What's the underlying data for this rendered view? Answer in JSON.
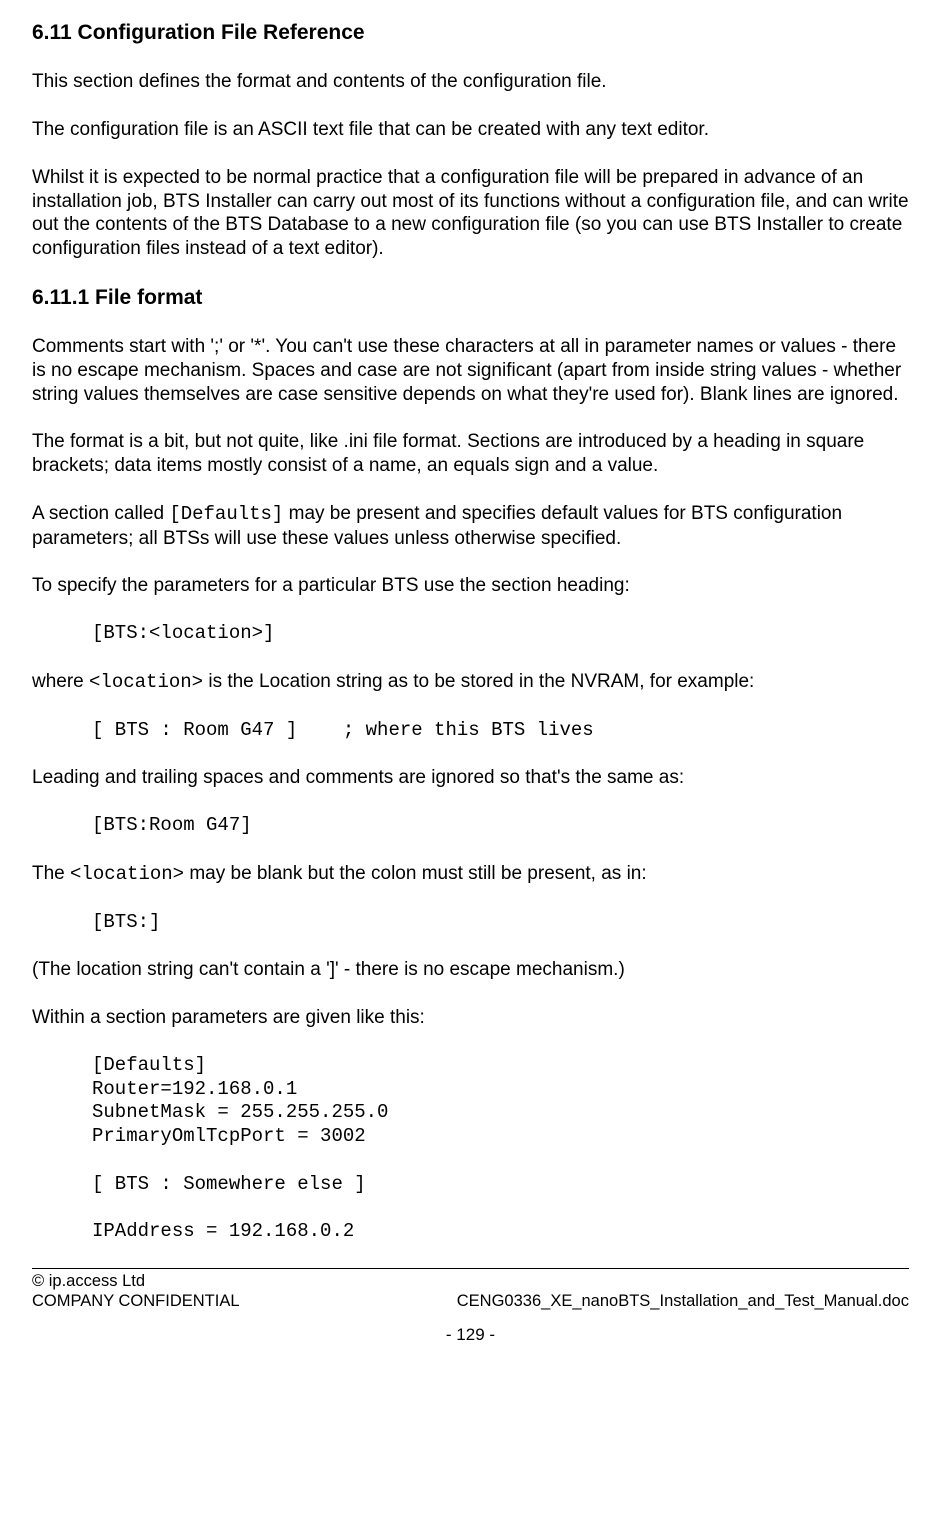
{
  "heading_main": "6.11 Configuration File Reference",
  "p1": "This section defines the format and contents of the configuration file.",
  "p2": "The configuration file is an ASCII text file that can be created with any text editor.",
  "p3": "Whilst it is expected to be normal practice that a configuration file will be prepared in advance of an installation job, BTS Installer can carry out most of its functions without a configuration file, and can write out the contents of the BTS Database to a new configuration file (so you can use BTS Installer to create configuration files instead of a text editor).",
  "heading_sub": "6.11.1 File format",
  "p4": "Comments start with ';' or '*'. You can't use these characters at all in parameter names or values - there is no escape mechanism. Spaces and case are not significant (apart from inside string  values - whether string values themselves are case sensitive depends on what they're used for). Blank lines are ignored.",
  "p5": "The format is a bit, but not quite, like .ini file format. Sections are introduced by a heading in square brackets; data items mostly consist of a name, an equals sign and a value.",
  "p6a": "A section called ",
  "p6_code": "[Defaults]",
  "p6b": " may be present and specifies default values for BTS configuration parameters; all BTSs will use these values unless otherwise specified.",
  "p7": "To specify the parameters for a particular BTS use the section heading:",
  "code1": "[BTS:<location>]",
  "p8a": "where ",
  "p8_code": "<location>",
  "p8b": " is the Location string as to be stored in the NVRAM, for example:",
  "code2": "[ BTS : Room G47 ]    ; where this BTS lives",
  "p9": "Leading and trailing spaces and comments are ignored so that's the same as:",
  "code3": "[BTS:Room G47]",
  "p10a": "The ",
  "p10_code": "<location>",
  "p10b": " may be blank but the colon must still be present, as in:",
  "code4": "[BTS:]",
  "p11": "(The location string can't contain a ']' - there is no escape mechanism.)",
  "p12": "Within a section parameters are given like this:",
  "code5": "[Defaults]\nRouter=192.168.0.1\nSubnetMask = 255.255.255.0\nPrimaryOmlTcpPort = 3002\n\n[ BTS : Somewhere else ]\n\nIPAddress = 192.168.0.2",
  "footer_copyright": "© ip.access Ltd",
  "footer_confidential": "COMPANY CONFIDENTIAL",
  "footer_docname": "CENG0336_XE_nanoBTS_Installation_and_Test_Manual.doc",
  "footer_pagenum": "- 129 -"
}
